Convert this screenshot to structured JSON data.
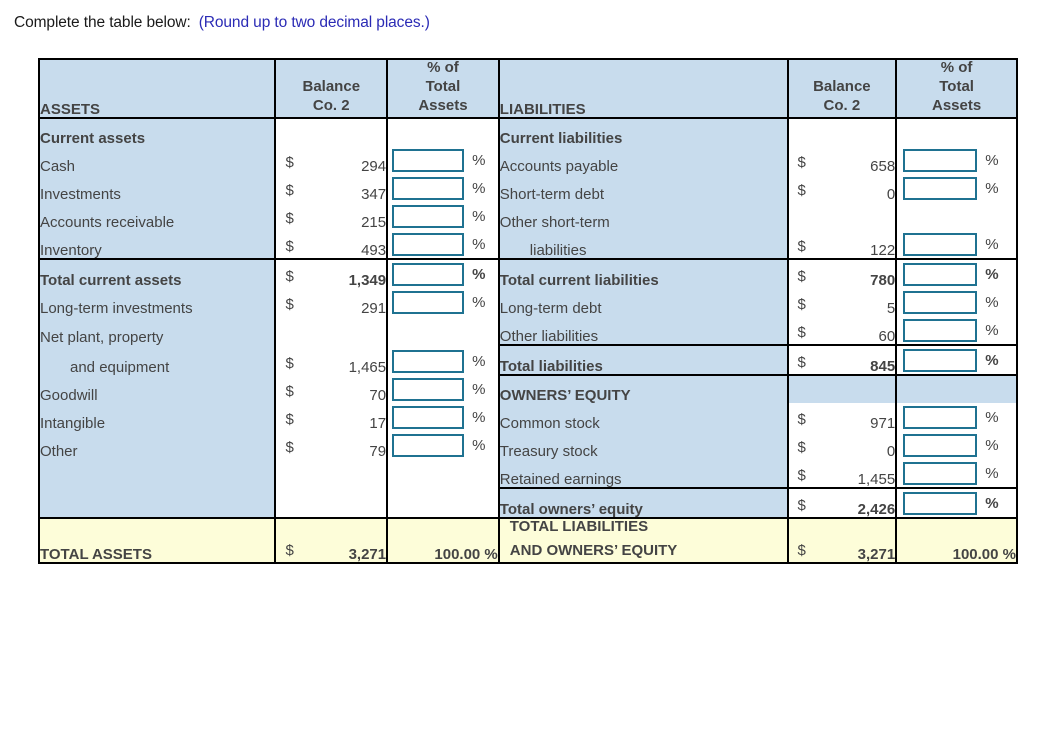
{
  "prompt": {
    "lead": "Complete the table below:",
    "hint": "(Round up to two decimal places.)"
  },
  "colors": {
    "header_fill": "#c8dced",
    "total_fill": "#fdfdd9",
    "input_border": "#1f7291",
    "text": "#444444",
    "hint_text": "#2b2bb5"
  },
  "headers": {
    "assets": "ASSETS",
    "liabilities": "LIABILITIES",
    "balance_1": "Balance",
    "balance_2": "Co. 2",
    "pct_1": "% of",
    "pct_2": "Total",
    "pct_3": "Assets",
    "currency": "$",
    "percent_sign": "%"
  },
  "assets": {
    "section_label": "Current assets",
    "rows": [
      {
        "label": "Cash",
        "value": "294",
        "indent": false,
        "bold": false,
        "has_input": true
      },
      {
        "label": "Investments",
        "value": "347",
        "indent": false,
        "bold": false,
        "has_input": true
      },
      {
        "label": "Accounts receivable",
        "value": "215",
        "indent": false,
        "bold": false,
        "has_input": true
      },
      {
        "label": "Inventory",
        "value": "493",
        "indent": false,
        "bold": false,
        "has_input": true
      },
      {
        "label": "Total current assets",
        "value": "1,349",
        "indent": false,
        "bold": true,
        "has_input": true
      },
      {
        "label": "Long-term investments",
        "value": "291",
        "indent": false,
        "bold": false,
        "has_input": true
      },
      {
        "label": "Net plant, property",
        "value": "",
        "indent": false,
        "bold": false,
        "has_input": false
      },
      {
        "label": "and equipment",
        "value": "1,465",
        "indent": true,
        "bold": false,
        "has_input": true
      },
      {
        "label": "Goodwill",
        "value": "70",
        "indent": false,
        "bold": false,
        "has_input": true
      },
      {
        "label": "Intangible",
        "value": "17",
        "indent": false,
        "bold": false,
        "has_input": true
      },
      {
        "label": "Other",
        "value": "79",
        "indent": false,
        "bold": false,
        "has_input": true
      }
    ],
    "total": {
      "label": "TOTAL ASSETS",
      "value": "3,271",
      "percent": "100.00 %"
    }
  },
  "liabilities": {
    "section_label": "Current liabilities",
    "rows": [
      {
        "label": "Accounts payable",
        "value": "658",
        "indent": false,
        "bold": false,
        "has_input": true
      },
      {
        "label": "Short-term debt",
        "value": "0",
        "indent": false,
        "bold": false,
        "has_input": true
      },
      {
        "label": "Other short-term",
        "value": "",
        "indent": false,
        "bold": false,
        "has_input": false
      },
      {
        "label": "liabilities",
        "value": "122",
        "indent": true,
        "bold": false,
        "has_input": true
      },
      {
        "label": "Total current liabilities",
        "value": "780",
        "indent": false,
        "bold": true,
        "has_input": true
      },
      {
        "label": "Long-term debt",
        "value": "5",
        "indent": false,
        "bold": false,
        "has_input": true
      },
      {
        "label": "Other liabilities",
        "value": "60",
        "indent": false,
        "bold": false,
        "has_input": true
      },
      {
        "label": "Total liabilities",
        "value": "845",
        "indent": false,
        "bold": true,
        "has_input": true
      }
    ],
    "equity_header": "OWNERS’ EQUITY",
    "equity_rows": [
      {
        "label": "Common stock",
        "value": "971",
        "indent": false,
        "bold": false,
        "has_input": true
      },
      {
        "label": "Treasury stock",
        "value": "0",
        "indent": false,
        "bold": false,
        "has_input": true
      },
      {
        "label": "Retained earnings",
        "value": "1,455",
        "indent": false,
        "bold": false,
        "has_input": true
      },
      {
        "label": "Total owners’ equity",
        "value": "2,426",
        "indent": false,
        "bold": true,
        "has_input": true
      }
    ],
    "total": {
      "label_1": "TOTAL LIABILITIES",
      "label_2": "AND OWNERS’ EQUITY",
      "value": "3,271",
      "percent": "100.00 %"
    }
  }
}
